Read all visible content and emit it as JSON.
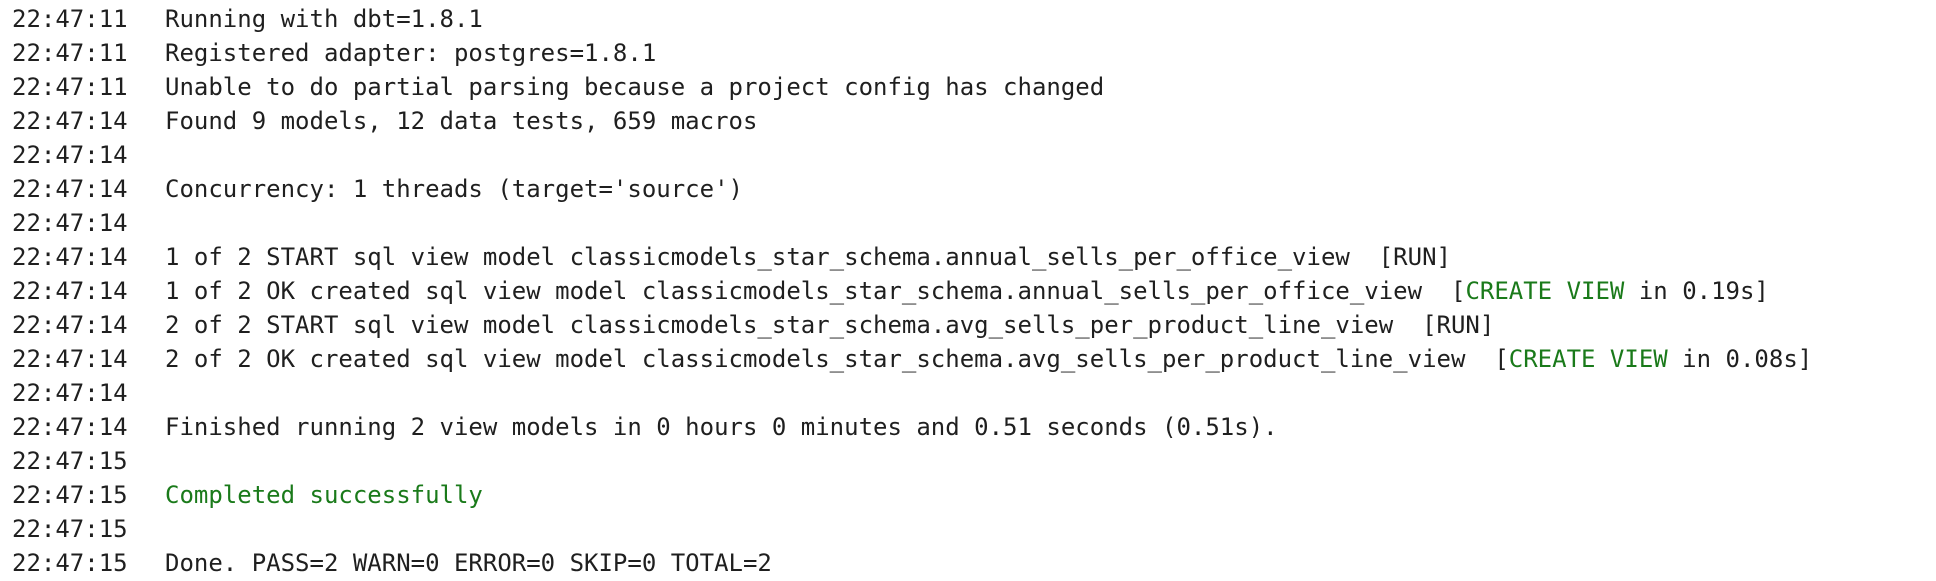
{
  "log": [
    {
      "time": "22:47:11",
      "text": "Running with dbt=1.8.1"
    },
    {
      "time": "22:47:11",
      "text": "Registered adapter: postgres=1.8.1"
    },
    {
      "time": "22:47:11",
      "text": "Unable to do partial parsing because a project config has changed"
    },
    {
      "time": "22:47:14",
      "text": "Found 9 models, 12 data tests, 659 macros"
    },
    {
      "time": "22:47:14",
      "text": ""
    },
    {
      "time": "22:47:14",
      "text": "Concurrency: 1 threads (target='source')"
    },
    {
      "time": "22:47:14",
      "text": ""
    },
    {
      "time": "22:47:14",
      "text": "1 of 2 START sql view model classicmodels_star_schema.annual_sells_per_office_view  [RUN]"
    },
    {
      "time": "22:47:14",
      "pre": "1 of 2 OK created sql view model classicmodels_star_schema.annual_sells_per_office_view  [",
      "status": "CREATE VIEW",
      "post": " in 0.19s]"
    },
    {
      "time": "22:47:14",
      "text": "2 of 2 START sql view model classicmodels_star_schema.avg_sells_per_product_line_view  [RUN]"
    },
    {
      "time": "22:47:14",
      "pre": "2 of 2 OK created sql view model classicmodels_star_schema.avg_sells_per_product_line_view  [",
      "status": "CREATE VIEW",
      "post": " in 0.08s]"
    },
    {
      "time": "22:47:14",
      "text": ""
    },
    {
      "time": "22:47:14",
      "text": "Finished running 2 view models in 0 hours 0 minutes and 0.51 seconds (0.51s)."
    },
    {
      "time": "22:47:15",
      "text": ""
    },
    {
      "time": "22:47:15",
      "success": "Completed successfully"
    },
    {
      "time": "22:47:15",
      "text": ""
    },
    {
      "time": "22:47:15",
      "text": "Done. PASS=2 WARN=0 ERROR=0 SKIP=0 TOTAL=2"
    }
  ],
  "colors": {
    "text": "#1f1f1f",
    "success": "#1a7a1a",
    "background": "#ffffff"
  }
}
